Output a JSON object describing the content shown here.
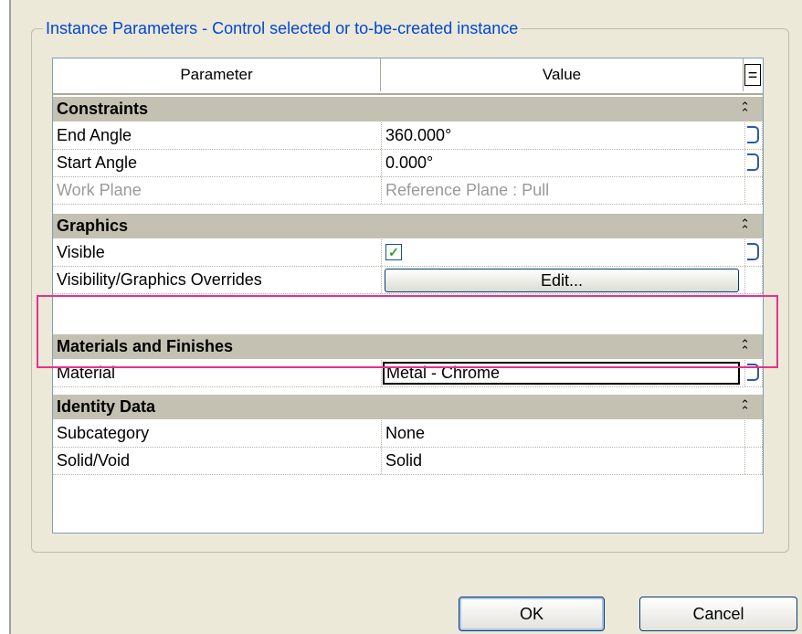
{
  "groupbox": {
    "title": "Instance Parameters - Control selected or to-be-created instance"
  },
  "grid": {
    "columns": {
      "parameter": "Parameter",
      "value": "Value",
      "menu": "="
    },
    "sections": [
      {
        "name": "Constraints",
        "collapse_icon": "double-chevron-up-icon",
        "rows": [
          {
            "parameter": "End Angle",
            "value": "360.000°"
          },
          {
            "parameter": "Start Angle",
            "value": "0.000°"
          },
          {
            "parameter": "Work Plane",
            "value": "Reference Plane : Pull",
            "disabled": true
          }
        ]
      },
      {
        "name": "Graphics",
        "collapse_icon": "double-chevron-up-icon",
        "rows": [
          {
            "parameter": "Visible",
            "value": "",
            "checked": true
          },
          {
            "parameter": "Visibility/Graphics Overrides",
            "value": "Edit..."
          }
        ]
      },
      {
        "name": "Materials and Finishes",
        "collapse_icon": "double-chevron-up-icon",
        "rows": [
          {
            "parameter": "Material",
            "value": "Metal - Chrome"
          }
        ]
      },
      {
        "name": "Identity Data",
        "collapse_icon": "double-chevron-up-icon",
        "rows": [
          {
            "parameter": "Subcategory",
            "value": "None"
          },
          {
            "parameter": "Solid/Void",
            "value": "Solid"
          }
        ]
      }
    ]
  },
  "buttons": {
    "ok": "OK",
    "cancel": "Cancel"
  },
  "colors": {
    "title_blue": "#0046d5",
    "highlight_pink": "#e8308e",
    "section_gray": "#c4c1b2",
    "dialog_bg": "#ece9d8"
  }
}
